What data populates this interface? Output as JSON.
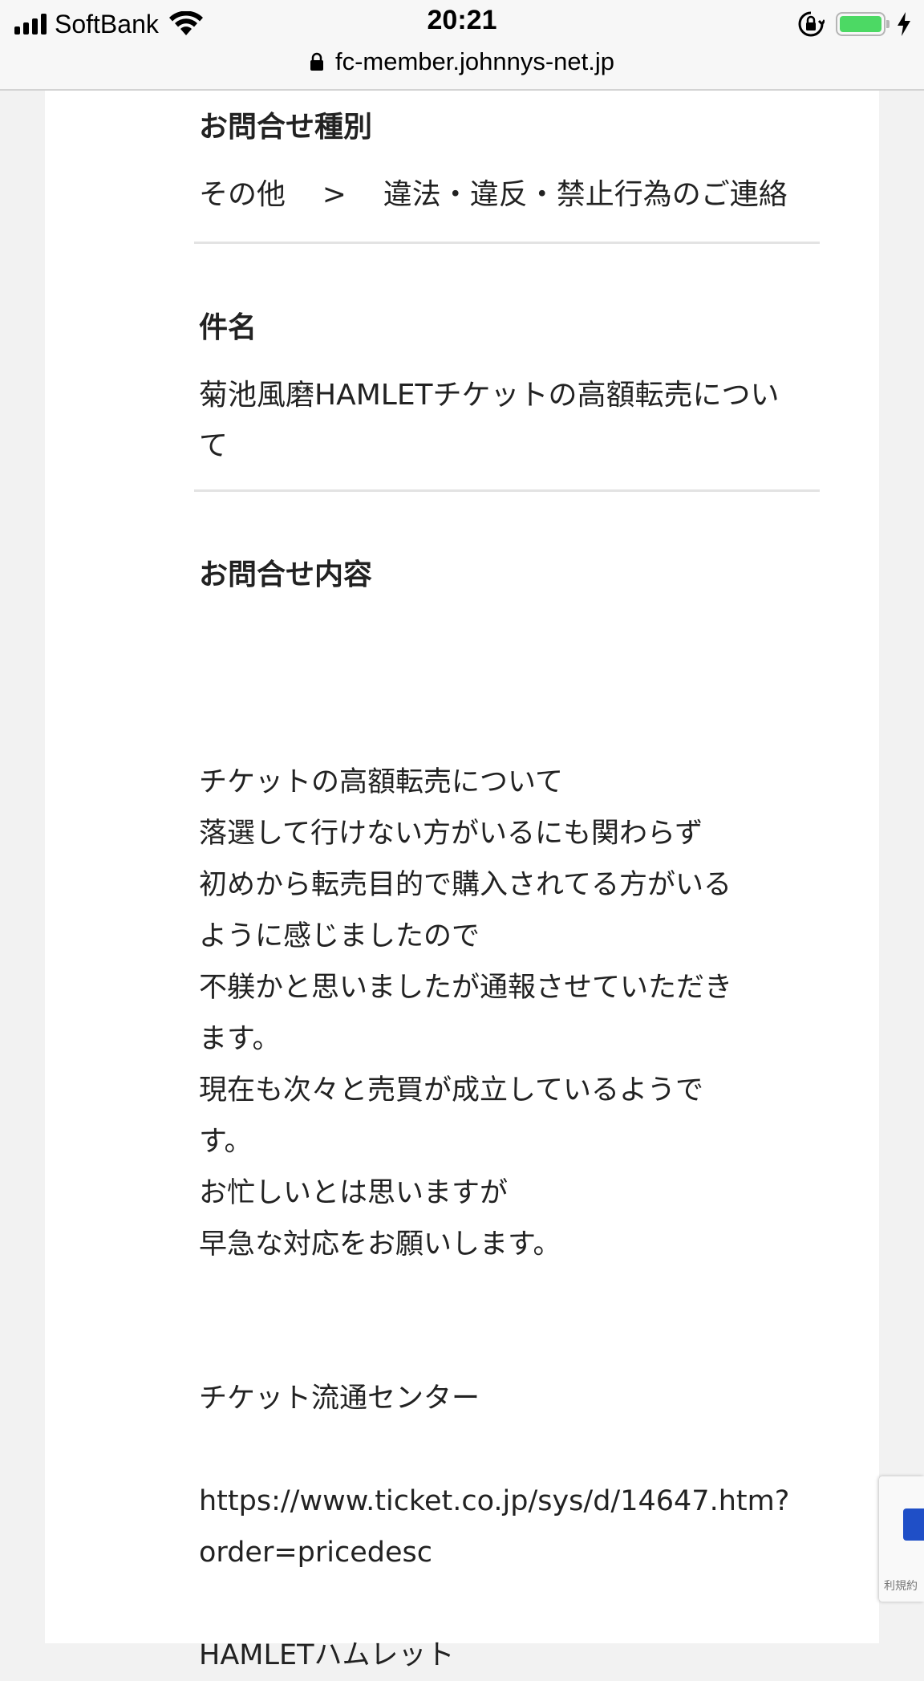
{
  "status_bar": {
    "carrier": "SoftBank",
    "time": "20:21",
    "url": "fc-member.johnnys-net.jp",
    "battery_level": 1.0
  },
  "inquiry_type": {
    "label": "お問合せ種別",
    "category": "その他",
    "separator": ">",
    "subcategory": "違法・違反・禁止行為のご連絡"
  },
  "subject": {
    "label": "件名",
    "lines": [
      "菊池風磨HAMLETチケットの高額転売につい",
      "て"
    ]
  },
  "inquiry_content": {
    "label": "お問合せ内容",
    "lines": [
      "チケットの高額転売について",
      "落選して行けない方がいるにも関わらず",
      "初めから転売目的で購入されてる方がいる",
      "ように感じましたので",
      "不躾かと思いましたが通報させていただき",
      "ます。",
      "現在も次々と売買が成立しているようで",
      "す。",
      "お忙しいとは思いますが",
      "早急な対応をお願いします。",
      "",
      "",
      "チケット流通センター",
      "",
      "https://www.ticket.co.jp/sys/d/14647.htm?",
      "order=pricedesc",
      "",
      "HAMLETハムレット"
    ]
  },
  "recaptcha": {
    "terms_fragment": "利規約"
  },
  "icons": {
    "signal": "signal-bars-icon",
    "wifi": "wifi-icon",
    "orientation_lock": "orientation-lock-icon",
    "battery": "battery-icon",
    "charging": "charging-bolt-icon",
    "secure": "padlock-icon"
  },
  "colors": {
    "battery_fill": "#4cd964",
    "page_bg": "#f2f2f2",
    "card_bg": "#ffffff",
    "divider": "#e3e3e3"
  }
}
